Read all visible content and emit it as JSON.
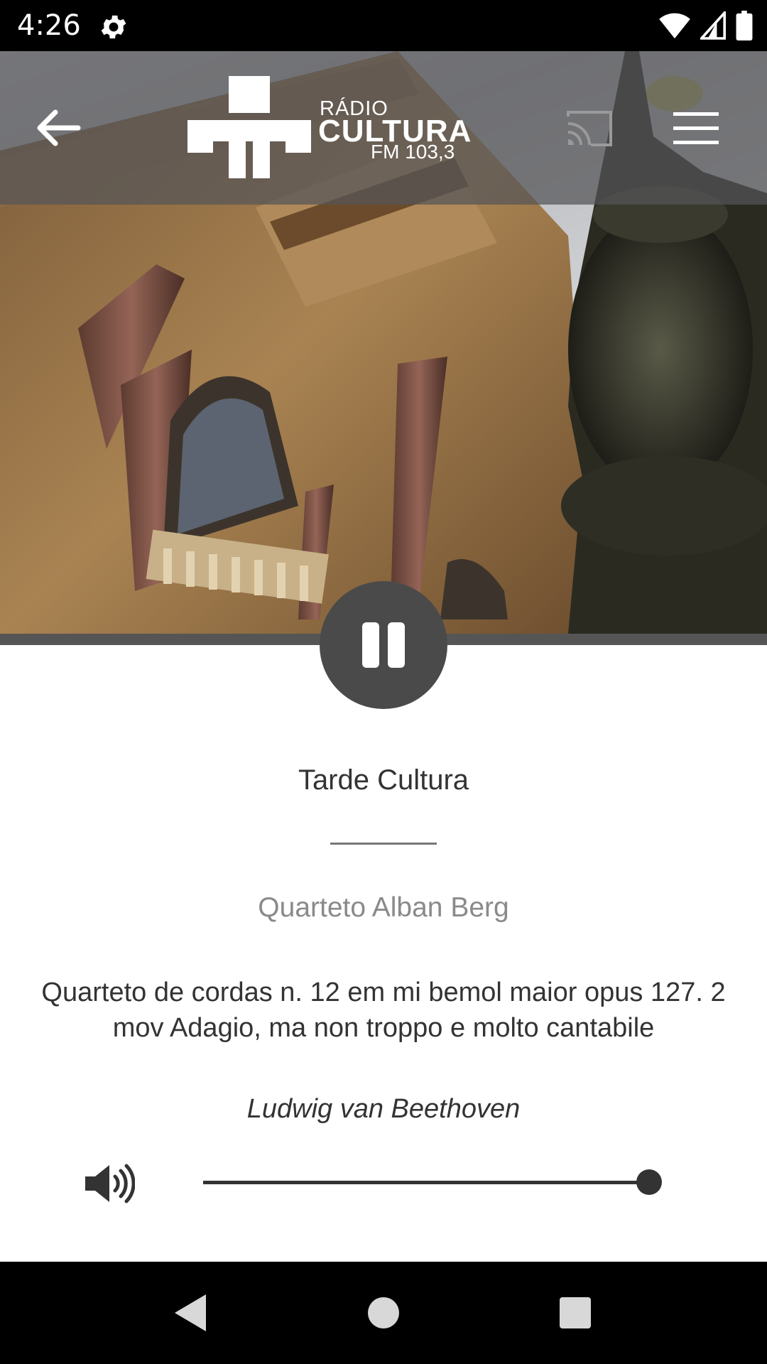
{
  "status_bar": {
    "time": "4:26",
    "icons": [
      "gear-icon",
      "wifi-icon",
      "signal-icon",
      "battery-icon"
    ]
  },
  "toolbar": {
    "back_icon": "arrow-left-icon",
    "logo": {
      "line1": "RÁDIO",
      "line2": "CULTURA",
      "line3": "FM 103,3"
    },
    "cast_icon": "cast-icon",
    "menu_icon": "hamburger-menu-icon"
  },
  "player": {
    "state_icon": "pause-icon",
    "program": "Tarde Cultura",
    "artist": "Quarteto Alban Berg",
    "track": "Quarteto de cordas n. 12 em mi bemol maior opus 127. 2 mov Adagio, ma non troppo e molto cantabile",
    "composer": "Ludwig van Beethoven",
    "volume_level": 1.0,
    "volume_icon": "volume-icon"
  },
  "nav_bar": {
    "icons": [
      "nav-back-icon",
      "nav-home-icon",
      "nav-recents-icon"
    ]
  },
  "colors": {
    "accent": "#4a4a4a",
    "toolbar_bg": "#555558",
    "secondary_text": "#8a8a8a"
  }
}
